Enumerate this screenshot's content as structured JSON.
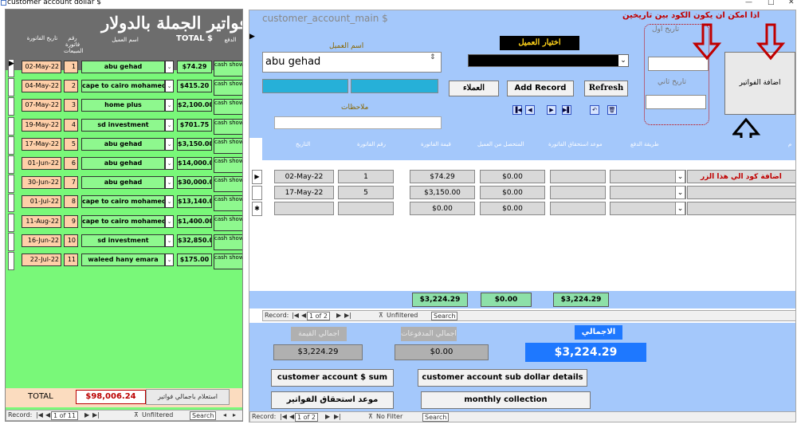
{
  "window": {
    "title": "customer account dollar $",
    "minimize": "—",
    "maximize": "□",
    "close": "✕"
  },
  "left": {
    "header_title": "ى فواتير الجملة بالدولار",
    "columns": {
      "date": "تاريخ الفاتورة",
      "invoice_no": "رقم فاتورة المبيعات",
      "customer": "اسم العميل",
      "total": "TOTAL $",
      "pay": "الدفع"
    },
    "rows": [
      {
        "date": "02-May-22",
        "no": "1",
        "customer": "abu gehad",
        "total": "$74.29",
        "pay": "cash show inside"
      },
      {
        "date": "04-May-22",
        "no": "2",
        "customer": "cape to cairo mohamed",
        "total": "$415.20",
        "pay": "cash show inside"
      },
      {
        "date": "07-May-22",
        "no": "3",
        "customer": "home plus",
        "total": "$2,100.00",
        "pay": "cash show inside"
      },
      {
        "date": "19-May-22",
        "no": "4",
        "customer": "sd investment",
        "total": "$701.75",
        "pay": "cash show inside"
      },
      {
        "date": "17-May-22",
        "no": "5",
        "customer": "abu gehad",
        "total": "$3,150.00",
        "pay": "cash show inside"
      },
      {
        "date": "01-Jun-22",
        "no": "6",
        "customer": "abu gehad",
        "total": "$14,000.00",
        "pay": "cash show inside"
      },
      {
        "date": "30-Jun-22",
        "no": "7",
        "customer": "abu gehad",
        "total": "$30,000.00",
        "pay": "cash show inside"
      },
      {
        "date": "01-Jul-22",
        "no": "8",
        "customer": "cape to cairo mohamed",
        "total": "$13,140.00",
        "pay": "cash show inside"
      },
      {
        "date": "11-Aug-22",
        "no": "9",
        "customer": "cape to cairo mohamed",
        "total": "$1,400.00",
        "pay": "cash show inside"
      },
      {
        "date": "16-Jun-22",
        "no": "10",
        "customer": "sd investment",
        "total": "$32,850.00",
        "pay": "cash show inside"
      },
      {
        "date": "22-Jul-22",
        "no": "11",
        "customer": "waleed hany emara",
        "total": "$175.00",
        "pay": "cash show inside"
      }
    ],
    "footer": {
      "total_label": "TOTAL",
      "total_value": "$98,006.24",
      "query_button": "استعلام باجمالي فواتير"
    },
    "nav": {
      "record": "Record:",
      "position": "1 of 11",
      "filter": "Unfiltered",
      "search": "Search"
    }
  },
  "right": {
    "title": "customer_account_main $",
    "customer_label": "اسم العميل",
    "customer_value": "abu gehad",
    "choose_customer_label": "اختيار العميل",
    "date_from_label": "تاريخ اول",
    "date_to_label": "تاريخ ثاني",
    "add_invoices_button": "اضافة الفواتير",
    "customers_button": "العملاء",
    "add_record_button": "Add Record",
    "refresh_button": "Refresh",
    "notes_label": "ملاحظات",
    "annotation_top": "اذا امكن ان يكون الكود بين تاريخين",
    "annotation_mid": "اضافة كود الي هذا الزر",
    "columns": {
      "date": "التاريخ",
      "invoice_no": "رقم الفاتورة",
      "invoice_value": "قيمة الفاتورة",
      "collected": "المتحصل من العميل",
      "due": "موعد استحقاق الفاتورة",
      "pay_method": "طريقة الدفع",
      "note": "م"
    },
    "rows": [
      {
        "date": "02-May-22",
        "no": "1",
        "value": "$74.29",
        "collected": "$0.00"
      },
      {
        "date": "17-May-22",
        "no": "5",
        "value": "$3,150.00",
        "collected": "$0.00"
      },
      {
        "date": "",
        "no": "",
        "value": "$0.00",
        "collected": "$0.00"
      }
    ],
    "sums": {
      "value": "$3,224.29",
      "collected": "$0.00",
      "balance": "$3,224.29"
    },
    "sub_nav": {
      "record": "Record:",
      "position": "1 of 2",
      "filter": "Unfiltered",
      "search": "Search"
    },
    "total_value_label": "اجمالي القيمة",
    "total_paid_label": "اجمالي المدفوعات",
    "total_label": "الاجمالي",
    "total_value": "$3,224.29",
    "total_paid": "$0.00",
    "grand_total": "$3,224.29",
    "btn_sum": "customer account $ sum",
    "btn_sub_details": "customer account sub dollar details",
    "btn_due": "موعد استحقاق الفواتير",
    "btn_monthly": "monthly collection",
    "nav": {
      "record": "Record:",
      "position": "1 of 2",
      "filter": "No Filter",
      "search": "Search"
    }
  }
}
